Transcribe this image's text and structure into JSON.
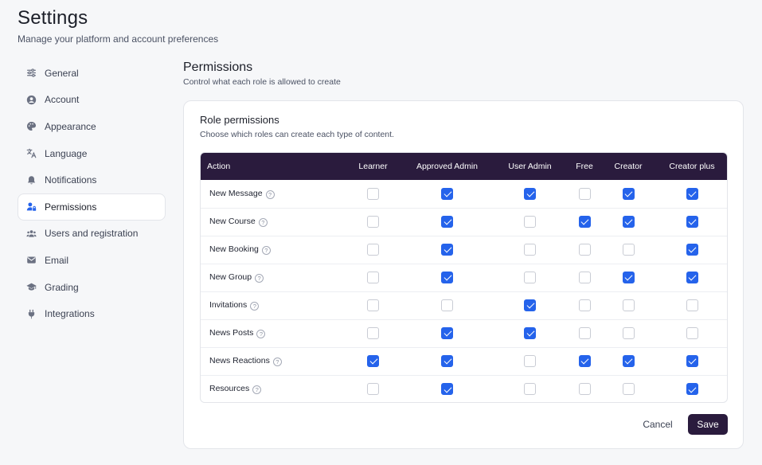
{
  "page": {
    "title": "Settings",
    "subtitle": "Manage your platform and account preferences"
  },
  "sidebar": {
    "items": [
      {
        "label": "General",
        "icon": "sliders-icon"
      },
      {
        "label": "Account",
        "icon": "user-circle-icon"
      },
      {
        "label": "Appearance",
        "icon": "palette-icon"
      },
      {
        "label": "Language",
        "icon": "translate-icon"
      },
      {
        "label": "Notifications",
        "icon": "bell-icon"
      },
      {
        "label": "Permissions",
        "icon": "user-lock-icon",
        "active": true
      },
      {
        "label": "Users and registration",
        "icon": "users-icon"
      },
      {
        "label": "Email",
        "icon": "envelope-icon"
      },
      {
        "label": "Grading",
        "icon": "graduation-cap-icon"
      },
      {
        "label": "Integrations",
        "icon": "plug-icon"
      }
    ]
  },
  "section": {
    "title": "Permissions",
    "subtitle": "Control what each role is allowed to create"
  },
  "card": {
    "title": "Role permissions",
    "subtitle": "Choose which roles can create each type of content."
  },
  "table": {
    "columns": [
      "Action",
      "Learner",
      "Approved Admin",
      "User Admin",
      "Free",
      "Creator",
      "Creator plus"
    ],
    "rows": [
      {
        "action": "New Message",
        "values": [
          false,
          true,
          true,
          false,
          true,
          true
        ]
      },
      {
        "action": "New Course",
        "values": [
          false,
          true,
          false,
          true,
          true,
          true
        ]
      },
      {
        "action": "New Booking",
        "values": [
          false,
          true,
          false,
          false,
          false,
          true
        ]
      },
      {
        "action": "New Group",
        "values": [
          false,
          true,
          false,
          false,
          true,
          true
        ]
      },
      {
        "action": "Invitations",
        "values": [
          false,
          false,
          true,
          false,
          false,
          false
        ]
      },
      {
        "action": "News Posts",
        "values": [
          false,
          true,
          true,
          false,
          false,
          false
        ]
      },
      {
        "action": "News Reactions",
        "values": [
          true,
          true,
          false,
          true,
          true,
          true
        ]
      },
      {
        "action": "Resources",
        "values": [
          false,
          true,
          false,
          false,
          false,
          true
        ]
      }
    ],
    "help_glyph": "?"
  },
  "actions": {
    "cancel_label": "Cancel",
    "save_label": "Save"
  },
  "colors": {
    "header_bg": "#2a1b3d",
    "checkbox_checked": "#2563eb",
    "save_bg": "#2a1b3d"
  }
}
